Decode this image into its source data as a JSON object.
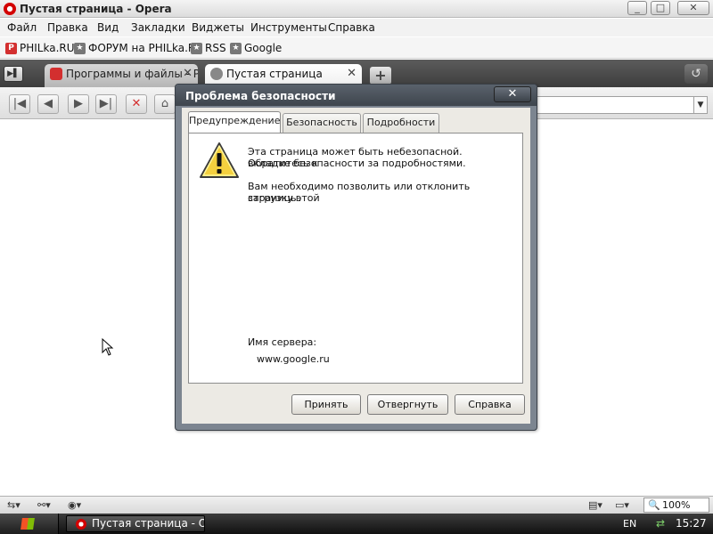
{
  "window": {
    "title": "Пустая страница - Opera",
    "controls": [
      "_",
      "□",
      "✕"
    ]
  },
  "menu": [
    "Файл",
    "Правка",
    "Вид",
    "Закладки",
    "Виджеты",
    "Инструменты",
    "Справка"
  ],
  "bookmarks": [
    {
      "label": "PHILka.RU",
      "icon": "philka-icon"
    },
    {
      "label": "ФОРУМ на PHILka.RU",
      "icon": "star-icon"
    },
    {
      "label": "RSS",
      "icon": "star-icon"
    },
    {
      "label": "Google",
      "icon": "star-icon"
    }
  ],
  "tabs": [
    {
      "label": "Программы и файлы - P...",
      "active": false
    },
    {
      "label": "Пустая страница",
      "active": true
    }
  ],
  "dialog": {
    "title": "Проблема безопасности",
    "close": "✕",
    "tabs": [
      "Предупреждение",
      "Безопасность",
      "Подробности"
    ],
    "active_tab": "Предупреждение",
    "message_1_line1": "Эта страница может быть небезопасной. Обратитесь к",
    "message_1_line2": "вкладке безопасности за подробностями.",
    "message_2_line1": "Вам необходимо позволить или отклонить загрузку этой",
    "message_2_line2": "страницы.",
    "server_label": "Имя сервера:",
    "server_value": "www.google.ru",
    "buttons": {
      "accept": "Принять",
      "reject": "Отвергнуть",
      "help": "Справка"
    }
  },
  "status": {
    "zoom": "100%"
  },
  "taskbar": {
    "item": "Пустая страница - O...",
    "lang": "EN",
    "clock": "15:27"
  },
  "colors": {
    "opera_red": "#d30000",
    "dialog_frame": "#7c8590",
    "tab_bar": "#4a4a4a"
  }
}
